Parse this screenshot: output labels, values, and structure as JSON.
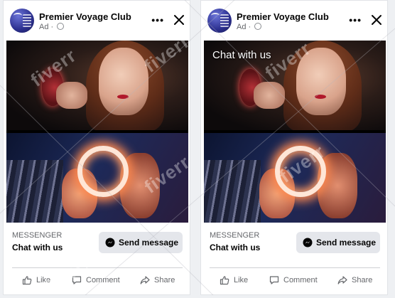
{
  "ads": [
    {
      "page_name": "Premier Voyage Club",
      "sponsored_label": "Ad",
      "overlay_text": "",
      "cta_caption": "MESSENGER",
      "cta_headline": "Chat with us",
      "button_label": "Send message",
      "actions": {
        "like": "Like",
        "comment": "Comment",
        "share": "Share"
      }
    },
    {
      "page_name": "Premier Voyage Club",
      "sponsored_label": "Ad",
      "overlay_text": "Chat with us",
      "cta_caption": "MESSENGER",
      "cta_headline": "Chat with us",
      "button_label": "Send message",
      "actions": {
        "like": "Like",
        "comment": "Comment",
        "share": "Share"
      }
    }
  ],
  "watermark_text": "fiverr",
  "colors": {
    "background": "#eef0f3",
    "card": "#ffffff",
    "button_bg": "#e4e6eb",
    "secondary_text": "#65676b",
    "messenger_icon": "#0a7cff"
  },
  "icons": [
    "more-options-icon",
    "close-icon",
    "globe-icon",
    "messenger-icon",
    "like-icon",
    "comment-icon",
    "share-icon"
  ]
}
